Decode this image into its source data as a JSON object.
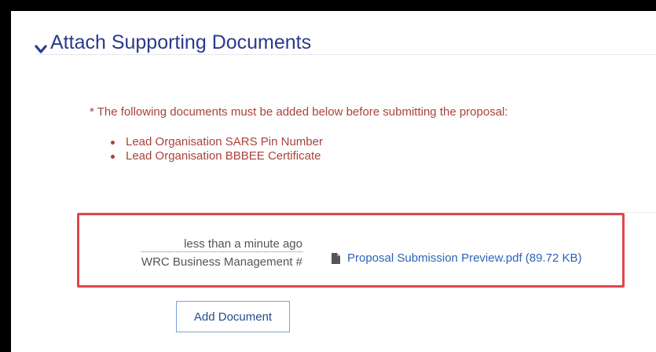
{
  "section": {
    "title": "Attach Supporting Documents",
    "icon": "chevron-down-icon"
  },
  "requirements": {
    "notice": "* The following documents must be added below before submitting the proposal:",
    "items": [
      "Lead Organisation SARS Pin Number",
      "Lead Organisation BBBEE Certificate"
    ]
  },
  "document": {
    "time": "less than a minute ago",
    "owner": "WRC Business Management #",
    "file_icon": "file-icon",
    "file_name": "Proposal Submission Preview.pdf (89.72 KB)"
  },
  "actions": {
    "add_document_label": "Add Document"
  },
  "colors": {
    "header": "#2a3a8a",
    "notice": "#a8423a",
    "link": "#2e63b8",
    "highlight": "#e0464b"
  }
}
